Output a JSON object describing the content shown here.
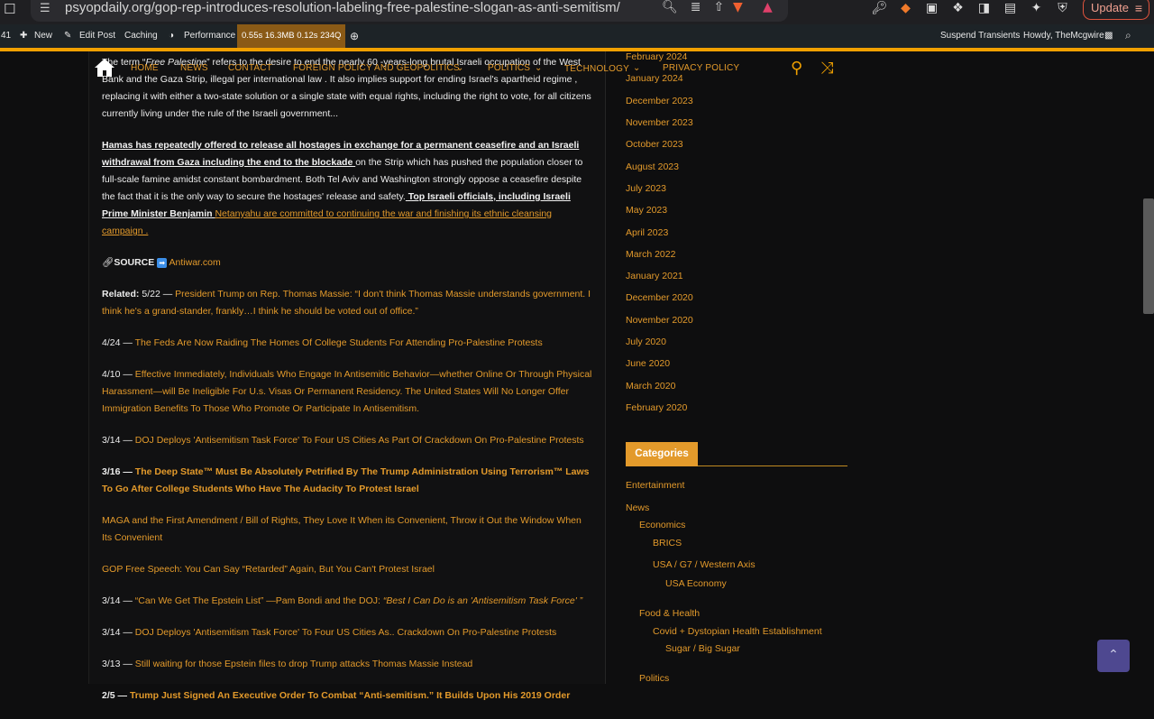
{
  "browser": {
    "url": "psyopdaily.org/gop-rep-introduces-resolution-labeling-free-palestine-slogan-as-anti-semitism/",
    "update_label": "Update"
  },
  "wp_admin": {
    "count": "41",
    "new": "New",
    "edit_post": "Edit Post",
    "caching": "Caching",
    "performance": "Performance",
    "perf_stats": "0.55s  16.3MB  0.12s  234Q",
    "suspend": "Suspend Transients",
    "howdy": "Howdy, TheMcgwire"
  },
  "nav": {
    "items": [
      "HOME",
      "NEWS",
      "CONTACT",
      "FOREIGN POLICY AND GEOPOLITICS",
      "POLITICS",
      "TECHNOLOGY",
      "PRIVACY POLICY"
    ]
  },
  "article": {
    "p1_prefix": "The term “",
    "p1_term": "Free Palestine",
    "p1_rest": "” refers to the desire to end the nearly 60 -years-long brutal Israeli occupation of the West Bank and the Gaza Strip, illegal per international law . It also implies support for ending Israel's apartheid regime , replacing it with either a two-state solution or a single state with equal rights, including the right to vote, for all citizens currently living under the rule of the Israeli government...",
    "p2_link1": "Hamas has repeatedly offered to release all hostages in exchange for a permanent ceasefire and an Israeli withdrawal from Gaza including the end to the blockade ",
    "p2_text": "on the Strip which has pushed the population closer to full-scale famine amidst constant bombardment. Both Tel Aviv and Washington strongly oppose a ceasefire despite the fact that it is the only way to secure the hostages' release and safety.",
    "p2_link2": " Top Israeli officials, including Israeli Prime Minister Benjamin ",
    "p2_link3": "Netanyahu are committed to continuing the war and finishing its ethnic cleansing campaign .",
    "source_label": "SOURCE",
    "source_link": "Antiwar.com",
    "related_label": "Related:",
    "related_date": " 5/22 — ",
    "related_link": "President Trump on Rep. Thomas Massie: “I don't think Thomas Massie understands government. I think he's a grand-stander, frankly…I think he should be voted out of office.”",
    "items": [
      {
        "date": "4/24 — ",
        "text": "The Feds Are Now Raiding The Homes Of College Students For Attending Pro-Palestine Protests"
      },
      {
        "date": "4/10 — ",
        "text": "Effective Immediately, Individuals Who Engage In Antisemitic Behavior—whether Online Or Through Physical Harassment—will Be Ineligible For U.s. Visas Or Permanent Residency. The United States Will No Longer Offer Immigration Benefits To Those Who Promote Or Participate In Antisemitism."
      },
      {
        "date": "3/14 — ",
        "text": "DOJ Deploys 'Antisemitism Task Force' To Four US Cities As Part Of Crackdown On Pro-Palestine Protests"
      },
      {
        "date": "3/16 — ",
        "text": "The Deep State™ Must Be Absolutely Petrified By The Trump Administration Using Terrorism™ Laws To Go After College Students Who Have The Audacity To Protest Israel"
      },
      {
        "date": "",
        "text": "MAGA and the First Amendment / Bill of Rights, They Love It When its Convenient, Throw it Out the Window When Its Convenient"
      },
      {
        "date": "",
        "text": "GOP Free Speech: You Can Say “Retarded” Again, But You Can't Protest Israel"
      },
      {
        "date": "3/14 — ",
        "text": "“Can We Get The Epstein List” —Pam Bondi and the DOJ: ",
        "italic": "“Best I Can Do is an 'Antisemitism Task Force' ”"
      },
      {
        "date": "3/14 — ",
        "text": "DOJ Deploys 'Antisemitism Task Force' To Four US Cities As.. Crackdown On Pro-Palestine Protests"
      },
      {
        "date": "3/13 — ",
        "text": "Still waiting for those Epstein files to drop Trump attacks Thomas Massie Instead"
      },
      {
        "date": "2/5 — ",
        "text": "Trump Just Signed An Executive Order To Combat “Anti-semitism.” It Builds Upon His 2019 Order"
      }
    ]
  },
  "sidebar": {
    "archives": [
      "February 2024",
      "January 2024",
      "December 2023",
      "November 2023",
      "October 2023",
      "August 2023",
      "July 2023",
      "May 2023",
      "April 2023",
      "March 2022",
      "January 2021",
      "December 2020",
      "November 2020",
      "July 2020",
      "June 2020",
      "March 2020",
      "February 2020"
    ],
    "categories_title": "Categories",
    "categories": [
      {
        "label": "Entertainment",
        "indent": 0
      },
      {
        "label": "News",
        "indent": 0
      },
      {
        "label": "Economics",
        "indent": 1
      },
      {
        "label": "BRICS",
        "indent": 2
      },
      {
        "label": "USA / G7 / Western Axis",
        "indent": 2
      },
      {
        "label": "USA Economy",
        "indent": 3
      },
      {
        "label": "Food & Health",
        "indent": 1
      },
      {
        "label": "Covid + Dystopian Health Establishment",
        "indent": 2
      },
      {
        "label": "Sugar / Big Sugar",
        "indent": 3
      },
      {
        "label": "Politics",
        "indent": 1
      }
    ]
  },
  "colors": {
    "accent": "#e39a2b",
    "admin_bar": "#1d2327",
    "background": "#0e0e0f"
  }
}
